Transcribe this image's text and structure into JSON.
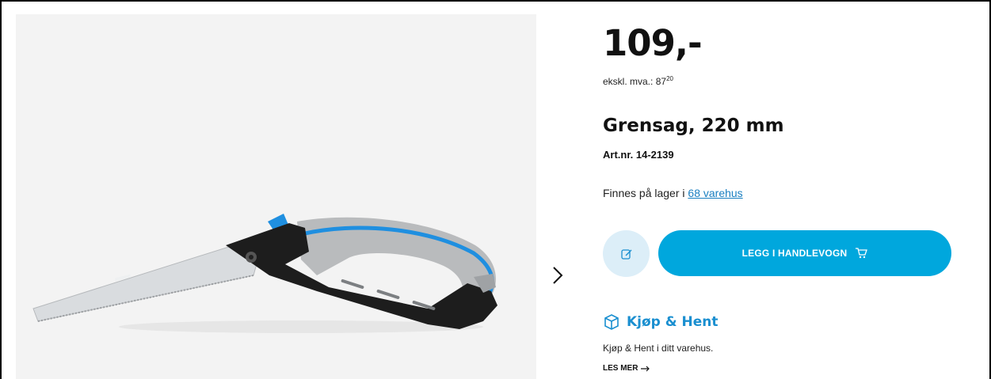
{
  "product": {
    "price": "109,-",
    "vat_label": "ekskl. mva.:",
    "vat_whole": "87",
    "vat_cents": "20",
    "title": "Grensag, 220 mm",
    "art_nr": "Art.nr. 14-2139"
  },
  "stock": {
    "prefix": "Finnes på lager i",
    "link": "68 varehus"
  },
  "actions": {
    "note_icon": "edit-note-icon",
    "add_to_cart": "LEGG I HANDLEVOGN",
    "cart_icon": "cart-icon"
  },
  "click_collect": {
    "title": "Kjøp & Hent",
    "description": "Kjøp & Hent i ditt varehus.",
    "read_more": "LES MER",
    "icon": "box-icon"
  },
  "colors": {
    "accent": "#00a7dd",
    "link": "#1a7fc1",
    "icon_blue": "#1a8fd0",
    "note_bg": "#dceef8"
  }
}
